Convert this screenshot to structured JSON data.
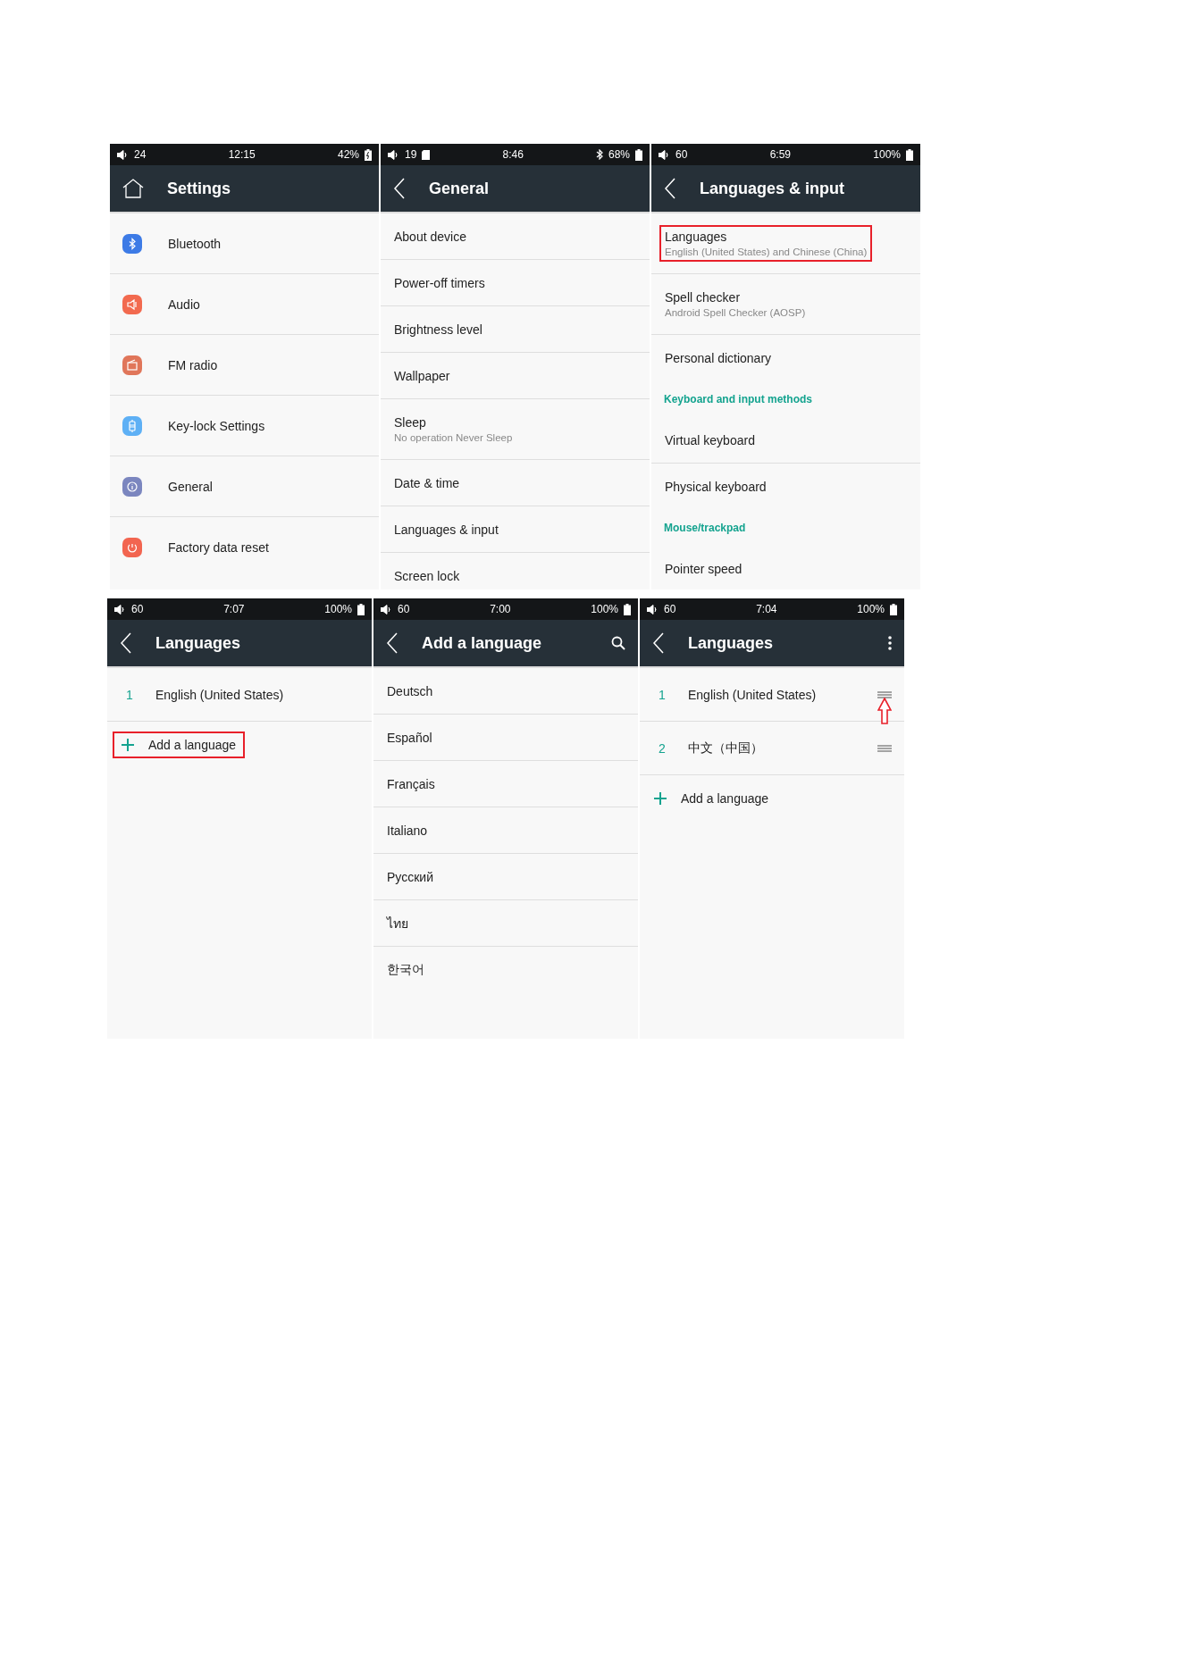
{
  "screens": [
    {
      "status": {
        "volume": "24",
        "time": "12:15",
        "battery": "42%",
        "sd": false,
        "bluetooth": false,
        "charging": true
      },
      "header": {
        "title": "Settings"
      },
      "items": [
        {
          "kind": "icon",
          "color": "#3d7be6",
          "label": "Bluetooth",
          "divider": true,
          "highlighted": false
        },
        {
          "kind": "icon",
          "color": "#f26a4f",
          "label": "Audio",
          "divider": true,
          "highlighted": false
        },
        {
          "kind": "icon",
          "color": "#e0765a",
          "label": "FM radio",
          "divider": true,
          "highlighted": false
        },
        {
          "kind": "icon",
          "color": "#5eb0f5",
          "label": "Key-lock Settings",
          "divider": true,
          "highlighted": false
        },
        {
          "kind": "icon",
          "color": "#7b86bf",
          "label": "General",
          "divider": true,
          "highlighted": false
        },
        {
          "kind": "icon",
          "color": "#f26550",
          "label": "Factory data reset",
          "highlighted": false
        }
      ]
    },
    {
      "status": {
        "volume": "19",
        "time": "8:46",
        "battery": "68%",
        "sd": true,
        "bluetooth": true,
        "charging": false
      },
      "header": {
        "title": "General"
      },
      "items": [
        {
          "kind": "plain",
          "label": "About device",
          "divider": true,
          "highlighted": false
        },
        {
          "kind": "plain",
          "label": "Power-off timers",
          "divider": true,
          "highlighted": false
        },
        {
          "kind": "plain",
          "label": "Brightness level",
          "divider": true,
          "highlighted": false
        },
        {
          "kind": "plain",
          "label": "Wallpaper",
          "divider": true,
          "highlighted": false
        },
        {
          "kind": "plain",
          "label": "Sleep",
          "subtitle": "No operation Never Sleep",
          "divider": true,
          "highlighted": false
        },
        {
          "kind": "plain",
          "label": "Date & time",
          "divider": true,
          "highlighted": false
        },
        {
          "kind": "plain",
          "label": "Languages & input",
          "divider": true,
          "highlighted": false
        },
        {
          "kind": "plain",
          "label": "Screen lock",
          "highlighted": false
        }
      ]
    },
    {
      "status": {
        "volume": "60",
        "time": "6:59",
        "battery": "100%",
        "sd": false,
        "bluetooth": false,
        "charging": false
      },
      "header": {
        "title": "Languages & input"
      },
      "items": [
        {
          "kind": "plain",
          "label": "Languages",
          "subtitle": "English (United States) and Chinese (China)",
          "divider": true,
          "highlighted": true
        },
        {
          "kind": "plain",
          "label": "Spell checker",
          "subtitle": "Android Spell Checker (AOSP)",
          "divider": true,
          "highlighted": false
        },
        {
          "kind": "plain",
          "label": "Personal dictionary",
          "divider": false,
          "highlighted": false
        },
        {
          "kind": "section",
          "label": "Keyboard and input methods"
        },
        {
          "kind": "plain",
          "label": "Virtual keyboard",
          "divider": true,
          "highlighted": false
        },
        {
          "kind": "plain",
          "label": "Physical keyboard",
          "divider": false,
          "highlighted": false
        },
        {
          "kind": "section",
          "label": "Mouse/trackpad"
        },
        {
          "kind": "plain",
          "label": "Pointer speed",
          "highlighted": false
        }
      ]
    },
    {
      "status": {
        "volume": "60",
        "time": "7:07",
        "battery": "100%",
        "sd": false,
        "bluetooth": false,
        "charging": false
      },
      "header": {
        "title": "Languages"
      },
      "items": [
        {
          "kind": "numbered",
          "number": "1",
          "label": "English (United States)",
          "handle": false,
          "arrow": false,
          "divider": true
        },
        {
          "kind": "add",
          "label": "Add a language",
          "highlighted": true
        }
      ]
    },
    {
      "status": {
        "volume": "60",
        "time": "7:00",
        "battery": "100%",
        "sd": false,
        "bluetooth": false,
        "charging": false
      },
      "header": {
        "title": "Add a language"
      },
      "items": [
        {
          "kind": "plain",
          "label": "Deutsch",
          "divider": true,
          "highlighted": false
        },
        {
          "kind": "plain",
          "label": "Español",
          "divider": true,
          "highlighted": false
        },
        {
          "kind": "plain",
          "label": "Français",
          "divider": true,
          "highlighted": false
        },
        {
          "kind": "plain",
          "label": "Italiano",
          "divider": true,
          "highlighted": false
        },
        {
          "kind": "plain",
          "label": "Русский",
          "divider": true,
          "highlighted": false
        },
        {
          "kind": "plain",
          "label": "ไทย",
          "divider": true,
          "highlighted": false
        },
        {
          "kind": "plain",
          "label": "한국어",
          "highlighted": false
        }
      ]
    },
    {
      "status": {
        "volume": "60",
        "time": "7:04",
        "battery": "100%",
        "sd": false,
        "bluetooth": false,
        "charging": false
      },
      "header": {
        "title": "Languages"
      },
      "items": [
        {
          "kind": "numbered",
          "number": "1",
          "label": "English (United States)",
          "handle": true,
          "arrow": true,
          "divider": true
        },
        {
          "kind": "numbered",
          "number": "2",
          "label": "中文（中国）",
          "handle": true,
          "arrow": false,
          "divider": true
        },
        {
          "kind": "add",
          "label": "Add a language",
          "highlighted": false
        }
      ]
    }
  ]
}
